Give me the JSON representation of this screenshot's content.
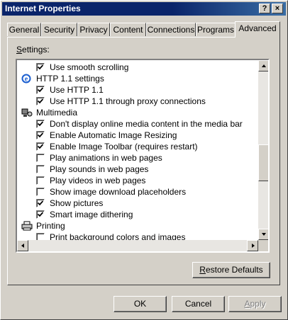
{
  "window": {
    "title": "Internet Properties",
    "help_label": "?",
    "close_label": "×"
  },
  "tabs": [
    {
      "label": "General"
    },
    {
      "label": "Security"
    },
    {
      "label": "Privacy"
    },
    {
      "label": "Content"
    },
    {
      "label": "Connections"
    },
    {
      "label": "Programs"
    },
    {
      "label": "Advanced",
      "active": true
    }
  ],
  "settings": {
    "label_prefix": "S",
    "label_rest": "ettings:",
    "items": [
      {
        "type": "option",
        "label": "Use smooth scrolling",
        "checked": true
      },
      {
        "type": "group",
        "label": "HTTP 1.1 settings",
        "icon": "ie-globe-icon"
      },
      {
        "type": "option",
        "label": "Use HTTP 1.1",
        "checked": true
      },
      {
        "type": "option",
        "label": "Use HTTP 1.1 through proxy connections",
        "checked": true
      },
      {
        "type": "group",
        "label": "Multimedia",
        "icon": "multimedia-icon"
      },
      {
        "type": "option",
        "label": "Don't display online media content in the media bar",
        "checked": true
      },
      {
        "type": "option",
        "label": "Enable Automatic Image Resizing",
        "checked": true
      },
      {
        "type": "option",
        "label": "Enable Image Toolbar (requires restart)",
        "checked": true
      },
      {
        "type": "option",
        "label": "Play animations in web pages",
        "checked": false
      },
      {
        "type": "option",
        "label": "Play sounds in web pages",
        "checked": false
      },
      {
        "type": "option",
        "label": "Play videos in web pages",
        "checked": false
      },
      {
        "type": "option",
        "label": "Show image download placeholders",
        "checked": false
      },
      {
        "type": "option",
        "label": "Show pictures",
        "checked": true
      },
      {
        "type": "option",
        "label": "Smart image dithering",
        "checked": true
      },
      {
        "type": "group",
        "label": "Printing",
        "icon": "printer-icon"
      },
      {
        "type": "option",
        "label": "Print background colors and images",
        "checked": false
      }
    ]
  },
  "buttons": {
    "restore_prefix": "R",
    "restore_rest": "estore Defaults",
    "ok": "OK",
    "cancel": "Cancel",
    "apply_prefix": "A",
    "apply_rest": "pply"
  },
  "colors": {
    "title_bar": "#0a246a",
    "face": "#d4d0c8",
    "disabled_text": "#808080"
  }
}
